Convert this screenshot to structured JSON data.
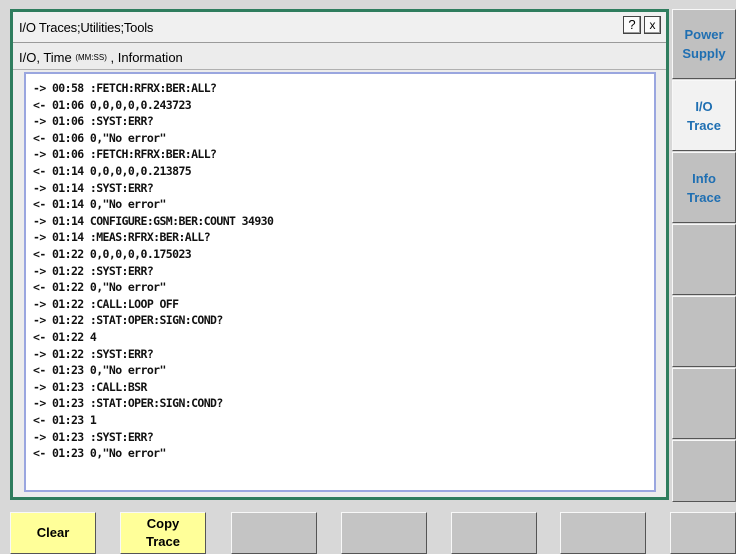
{
  "window": {
    "title": "I/O Traces;Utilities;Tools",
    "help_glyph": "?",
    "close_glyph": "x",
    "header_part1": "I/O, Time ",
    "header_small": "(MM:SS)",
    "header_part2": " , Information"
  },
  "trace": [
    "-> 00:58 :FETCH:RFRX:BER:ALL?",
    "<- 01:06 0,0,0,0,0.243723",
    "-> 01:06 :SYST:ERR?",
    "<- 01:06 0,\"No error\"",
    "-> 01:06 :FETCH:RFRX:BER:ALL?",
    "<- 01:14 0,0,0,0,0.213875",
    "-> 01:14 :SYST:ERR?",
    "<- 01:14 0,\"No error\"",
    "-> 01:14 CONFIGURE:GSM:BER:COUNT 34930",
    "-> 01:14 :MEAS:RFRX:BER:ALL?",
    "<- 01:22 0,0,0,0,0.175023",
    "-> 01:22 :SYST:ERR?",
    "<- 01:22 0,\"No error\"",
    "-> 01:22 :CALL:LOOP OFF",
    "-> 01:22 :STAT:OPER:SIGN:COND?",
    "<- 01:22 4",
    "-> 01:22 :SYST:ERR?",
    "<- 01:23 0,\"No error\"",
    "-> 01:23 :CALL:BSR",
    "-> 01:23 :STAT:OPER:SIGN:COND?",
    "<- 01:23 1",
    "-> 01:23 :SYST:ERR?",
    "<- 01:23 0,\"No error\""
  ],
  "side_menu": {
    "power_supply_1": "Power",
    "power_supply_2": "Supply",
    "io_trace_1": "I/O",
    "io_trace_2": "Trace",
    "info_trace_1": "Info",
    "info_trace_2": "Trace"
  },
  "softkeys": {
    "clear": "Clear",
    "copy_trace_1": "Copy",
    "copy_trace_2": "Trace"
  },
  "colors": {
    "accent_blue": "#1f6fb2",
    "window_border_green": "#2f7d5e",
    "softkey_yellow": "#ffff99",
    "trace_border": "#9aa6df"
  }
}
